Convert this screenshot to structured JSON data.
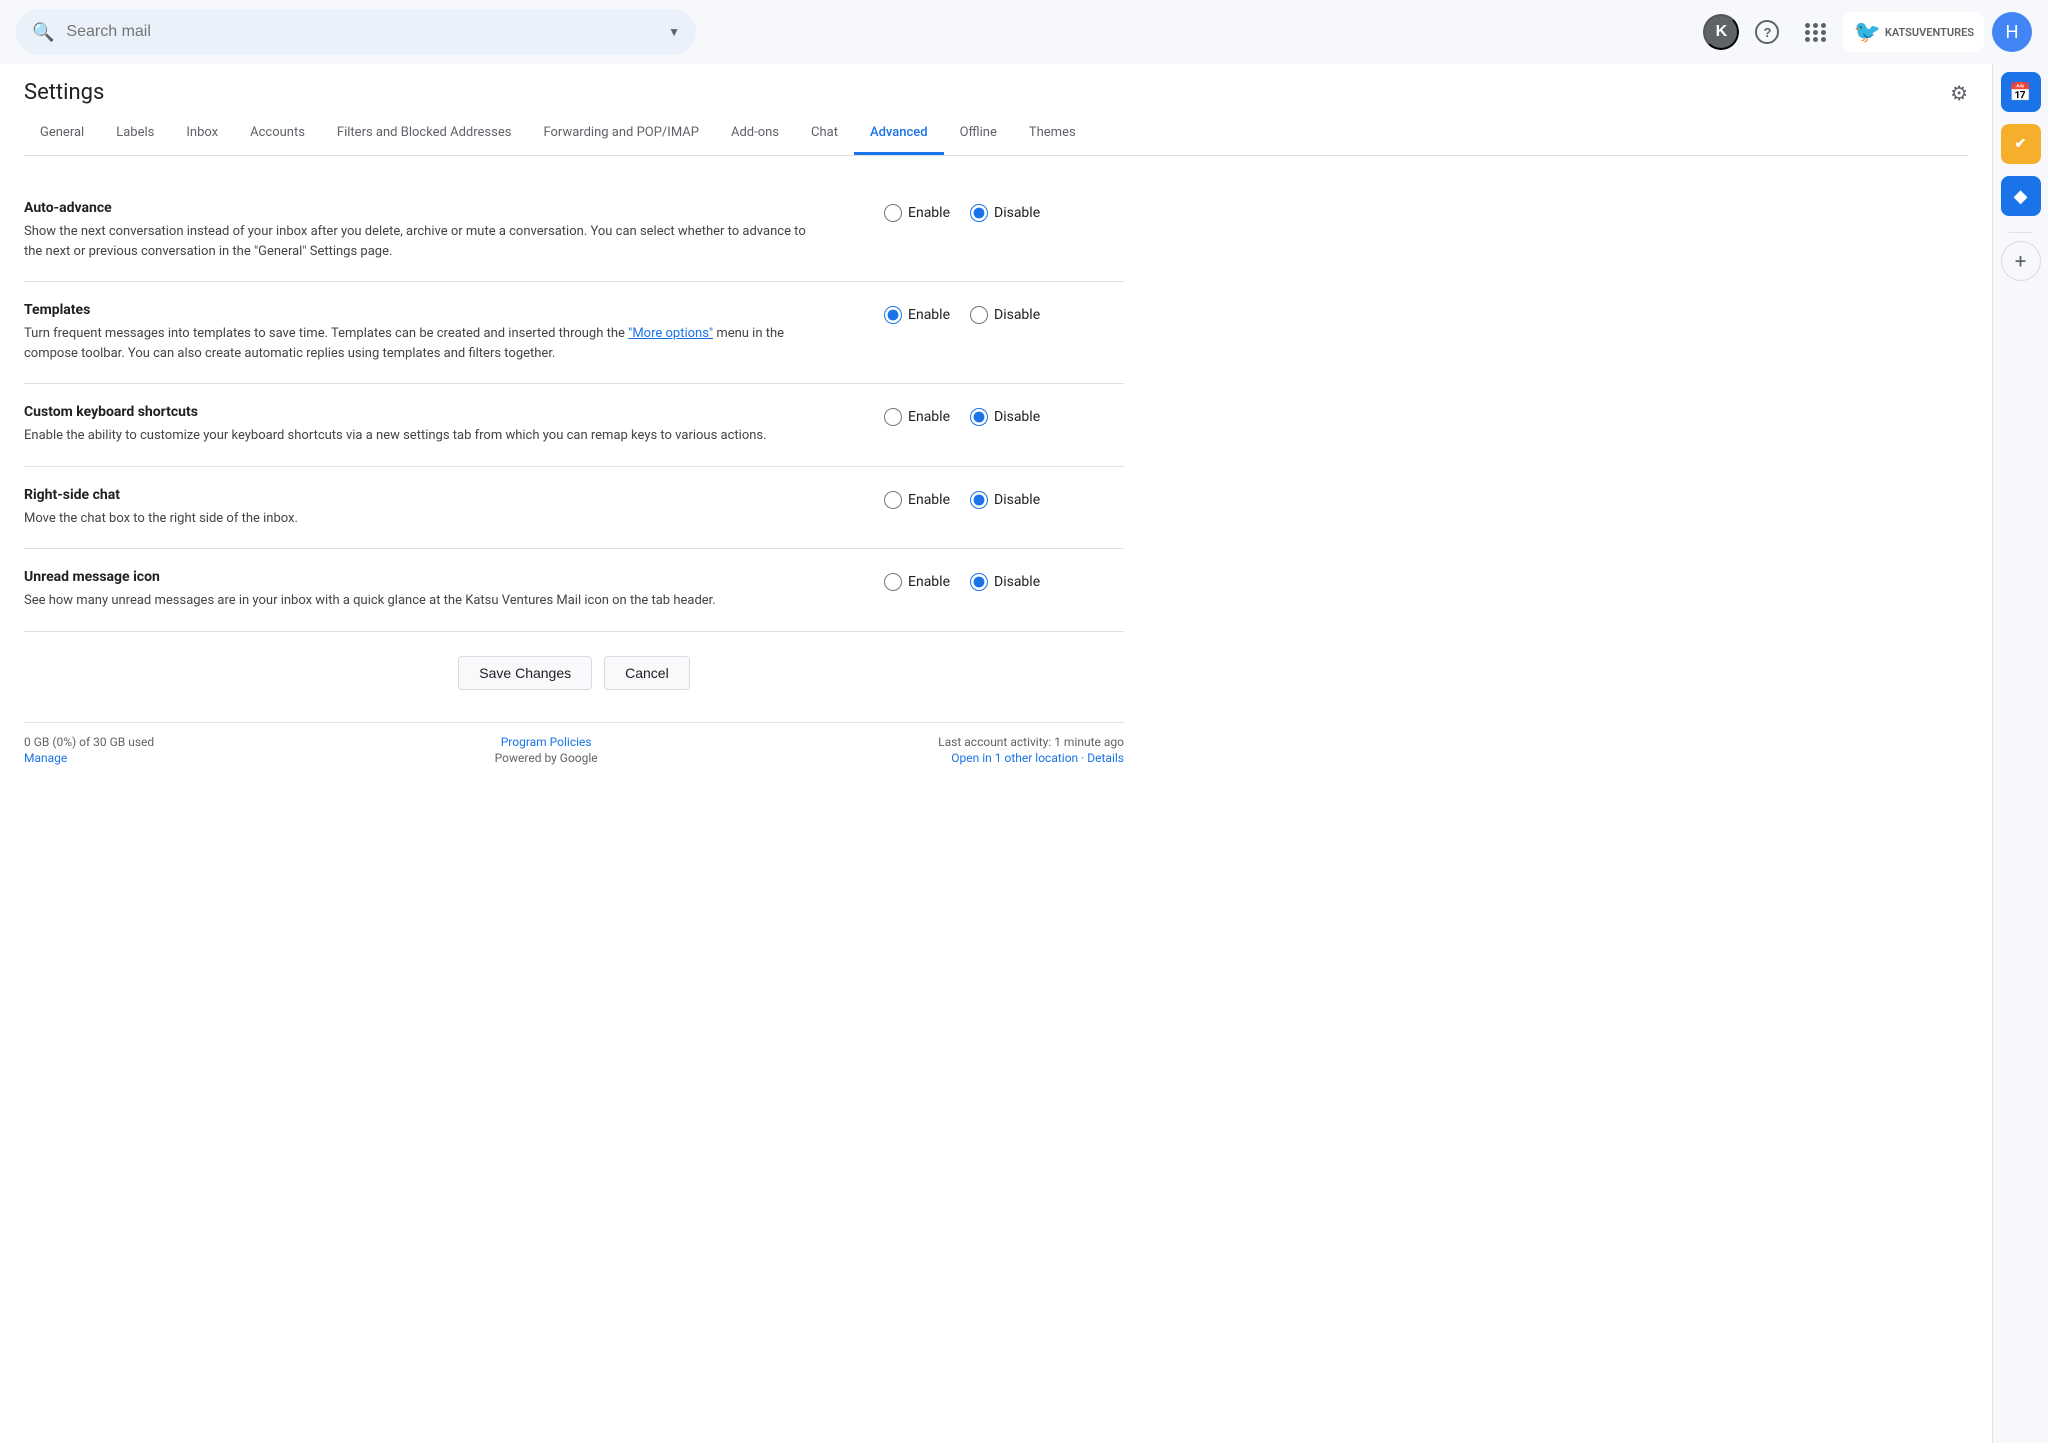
{
  "topbar": {
    "search_placeholder": "Search mail",
    "search_value": ""
  },
  "settings": {
    "title": "Settings",
    "tabs": [
      {
        "id": "general",
        "label": "General",
        "active": false
      },
      {
        "id": "labels",
        "label": "Labels",
        "active": false
      },
      {
        "id": "inbox",
        "label": "Inbox",
        "active": false
      },
      {
        "id": "accounts",
        "label": "Accounts",
        "active": false
      },
      {
        "id": "filters",
        "label": "Filters and Blocked Addresses",
        "active": false
      },
      {
        "id": "forwarding",
        "label": "Forwarding and POP/IMAP",
        "active": false
      },
      {
        "id": "addons",
        "label": "Add-ons",
        "active": false
      },
      {
        "id": "chat",
        "label": "Chat",
        "active": false
      },
      {
        "id": "advanced",
        "label": "Advanced",
        "active": true
      },
      {
        "id": "offline",
        "label": "Offline",
        "active": false
      },
      {
        "id": "themes",
        "label": "Themes",
        "active": false
      }
    ],
    "sections": [
      {
        "id": "auto-advance",
        "title": "Auto-advance",
        "description": "Show the next conversation instead of your inbox after you delete, archive or mute a conversation. You can select whether to advance to the next or previous conversation in the \"General\" Settings page.",
        "enable_selected": false,
        "disable_selected": true
      },
      {
        "id": "templates",
        "title": "Templates",
        "description_before_link": "Turn frequent messages into templates to save time. Templates can be created and inserted through the ",
        "link_text": "\"More options\"",
        "description_after_link": " menu in the compose toolbar. You can also create automatic replies using templates and filters together.",
        "enable_selected": true,
        "disable_selected": false
      },
      {
        "id": "custom-keyboard-shortcuts",
        "title": "Custom keyboard shortcuts",
        "description": "Enable the ability to customize your keyboard shortcuts via a new settings tab from which you can remap keys to various actions.",
        "enable_selected": false,
        "disable_selected": true
      },
      {
        "id": "right-side-chat",
        "title": "Right-side chat",
        "description": "Move the chat box to the right side of the inbox.",
        "enable_selected": false,
        "disable_selected": true
      },
      {
        "id": "unread-message-icon",
        "title": "Unread message icon",
        "description": "See how many unread messages are in your inbox with a quick glance at the Katsu Ventures Mail icon on the tab header.",
        "enable_selected": false,
        "disable_selected": true
      }
    ],
    "buttons": {
      "save": "Save Changes",
      "cancel": "Cancel"
    },
    "footer": {
      "storage": "0 GB (0%) of 30 GB used",
      "manage": "Manage",
      "policies": "Program Policies",
      "powered_by": "Powered by Google",
      "last_activity": "Last account activity: 1 minute ago",
      "open_location": "Open in 1 other location · Details"
    }
  },
  "right_sidebar": {
    "items": [
      {
        "id": "calendar",
        "icon": "📅",
        "color": "#1a73e8"
      },
      {
        "id": "tasks",
        "icon": "✔",
        "color": "#f6ae2d"
      },
      {
        "id": "keep",
        "icon": "◆",
        "color": "#1a73e8"
      },
      {
        "id": "add",
        "icon": "+",
        "color": "#5f6368"
      }
    ]
  },
  "user": {
    "avatar_letter": "H",
    "k_letter": "K"
  }
}
